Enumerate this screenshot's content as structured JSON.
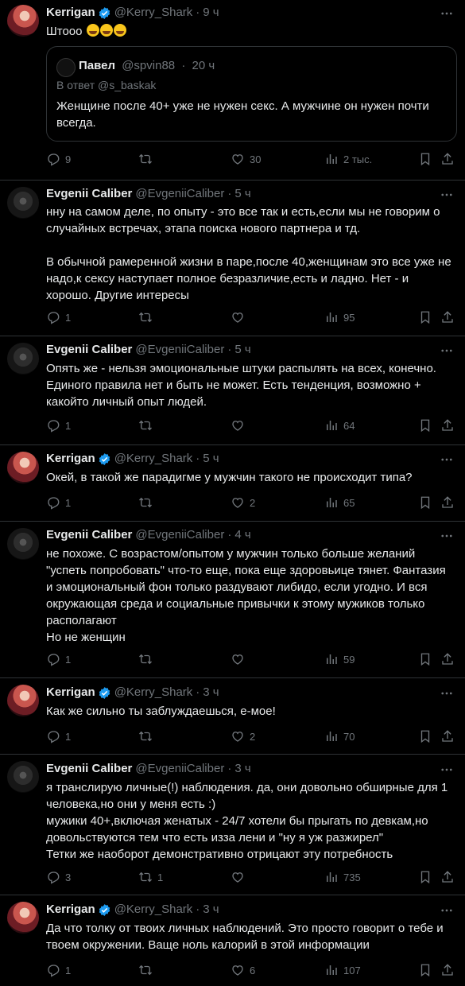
{
  "colors": {
    "background": "#000000",
    "text": "#e7e9ea",
    "muted": "#71767b",
    "border": "#2f3336",
    "verified": "#1d9bf0"
  },
  "tweets": [
    {
      "name": "Kerrigan",
      "verified": true,
      "handle": "@Kerry_Shark",
      "time": "9 ч",
      "text": "Штооо",
      "emojis": "rolling-on-floor-laughing x3",
      "quote": {
        "name": "Павел",
        "handle": "@spvin88",
        "time": "20 ч",
        "reply_to": "В ответ @s_baskak",
        "text": "Женщине после 40+ уже не нужен секс. А мужчине он нужен почти всегда."
      },
      "replies": "9",
      "retweets": "",
      "likes": "30",
      "views": "2 тыс."
    },
    {
      "name": "Evgenii Caliber",
      "verified": false,
      "handle": "@EvgeniiCaliber",
      "time": "5 ч",
      "text": "нну на самом деле, по опыту - это все так и есть,если мы не говорим о случайных встречах, этапа поиска нового партнера и тд.\n\nВ обычной рамеренной жизни в паре,после 40,женщинам это все уже не надо,к сексу наступает полное безразличие,есть и ладно. Нет - и хорошо. Другие интересы",
      "replies": "1",
      "retweets": "",
      "likes": "",
      "views": "95"
    },
    {
      "name": "Evgenii Caliber",
      "verified": false,
      "handle": "@EvgeniiCaliber",
      "time": "5 ч",
      "text": "Опять же - нельзя эмоциональные штуки распылять на всех, конечно. Единого правила нет и быть не может. Есть тенденция, возможно + какойто личный опыт людей.",
      "replies": "1",
      "retweets": "",
      "likes": "",
      "views": "64"
    },
    {
      "name": "Kerrigan",
      "verified": true,
      "handle": "@Kerry_Shark",
      "time": "5 ч",
      "text": "Окей, в такой же парадигме у мужчин такого не происходит типа?",
      "replies": "1",
      "retweets": "",
      "likes": "2",
      "views": "65"
    },
    {
      "name": "Evgenii Caliber",
      "verified": false,
      "handle": "@EvgeniiCaliber",
      "time": "4 ч",
      "text": "не похоже. С возрастом/опытом у мужчин только больше желаний \"успеть попробовать\" что-то еще, пока еще здоровьице тянет. Фантазия и эмоциональный фон только раздувают либидо, если угодно. И вся окружающая среда и социальные привычки к этому мужиков только располагают\nНо не женщин",
      "replies": "1",
      "retweets": "",
      "likes": "",
      "views": "59"
    },
    {
      "name": "Kerrigan",
      "verified": true,
      "handle": "@Kerry_Shark",
      "time": "3 ч",
      "text": "Как же сильно ты заблуждаешься, е-мое!",
      "replies": "1",
      "retweets": "",
      "likes": "2",
      "views": "70"
    },
    {
      "name": "Evgenii Caliber",
      "verified": false,
      "handle": "@EvgeniiCaliber",
      "time": "3 ч",
      "text": "я транслирую личные(!) наблюдения. да, они довольно обширные для 1 человека,но они у меня есть :)\nмужики 40+,включая женатых - 24/7 хотели бы прыгать по девкам,но довольствуются тем что есть изза лени и \"ну я уж разжирел\"\nТетки же наоборот демонстративно отрицают эту потребность",
      "replies": "3",
      "retweets": "1",
      "likes": "",
      "views": "735"
    },
    {
      "name": "Kerrigan",
      "verified": true,
      "handle": "@Kerry_Shark",
      "time": "3 ч",
      "text": "Да что толку от твоих личных наблюдений. Это просто говорит о тебе и твоем окружении. Ваще ноль калорий в этой информации",
      "replies": "1",
      "retweets": "",
      "likes": "6",
      "views": "107"
    }
  ]
}
